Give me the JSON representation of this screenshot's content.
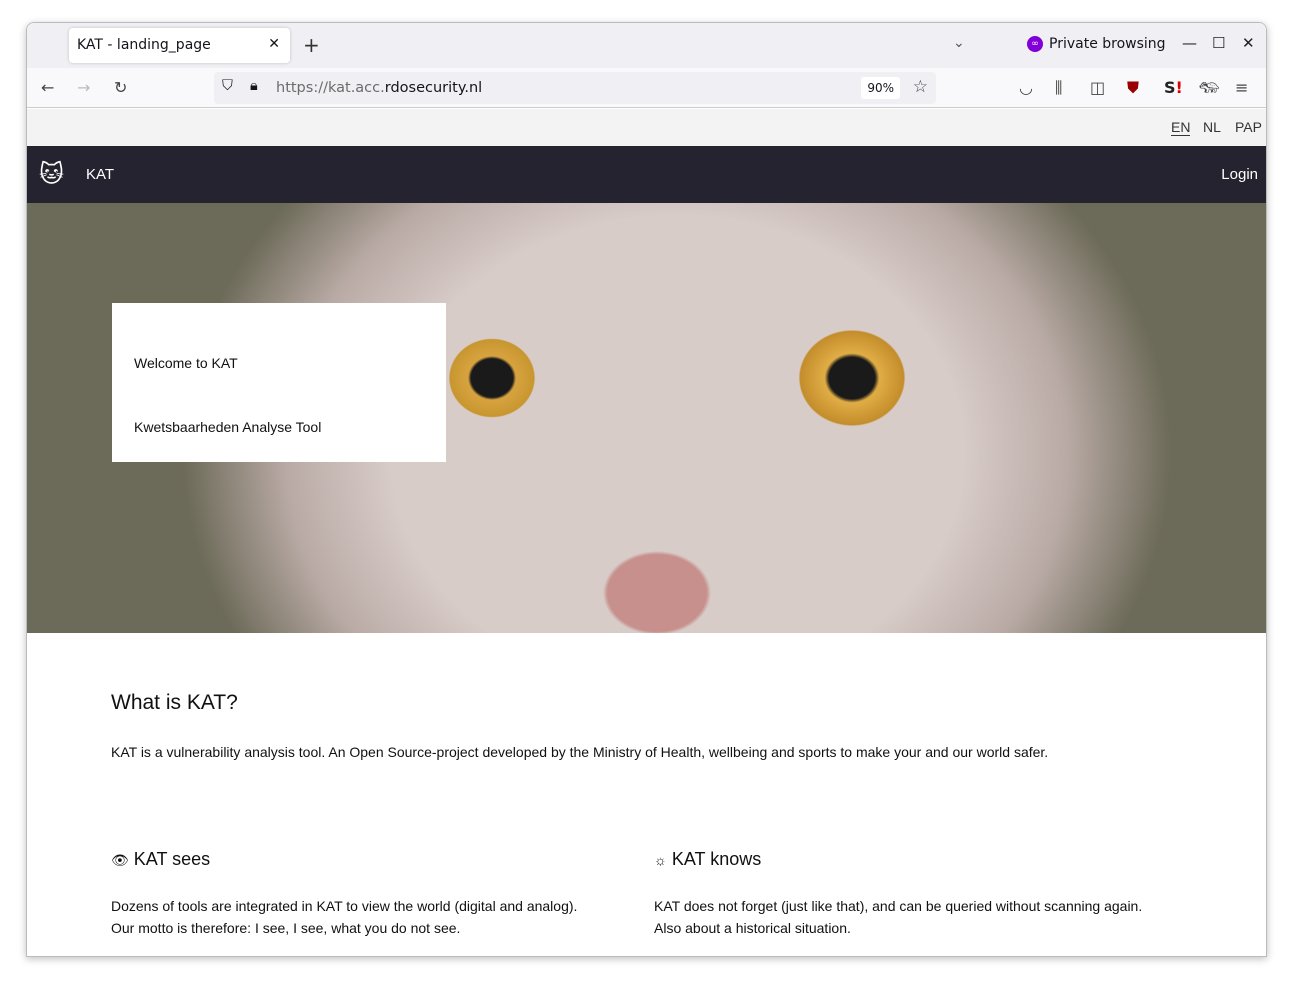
{
  "browser": {
    "tab_title": "KAT - landing_page",
    "private_label": "Private browsing",
    "url_prefix": "https://kat.acc.",
    "url_domain": "rdosecurity.nl",
    "zoom": "90%",
    "accent": "#8000d7"
  },
  "languages": [
    "EN",
    "NL",
    "PAP"
  ],
  "active_language": "EN",
  "nav": {
    "brand": "KAT",
    "login": "Login"
  },
  "hero": {
    "title": "Welcome to KAT",
    "subtitle": "Kwetsbaarheden Analyse Tool"
  },
  "about": {
    "heading": "What is KAT?",
    "text": "KAT is a vulnerability analysis tool. An Open Source-project developed by the Ministry of Health, wellbeing and sports to make your and our world safer."
  },
  "features": [
    {
      "icon": "eye-icon",
      "title": "KAT sees",
      "line1": "Dozens of tools are integrated in KAT to view the world (digital and analog).",
      "line2": "Our motto is therefore: I see, I see, what you do not see."
    },
    {
      "icon": "lightbulb-icon",
      "title": "KAT knows",
      "line1": "KAT does not forget (just like that), and can be queried without scanning again.",
      "line2": "Also about a historical situation."
    }
  ]
}
